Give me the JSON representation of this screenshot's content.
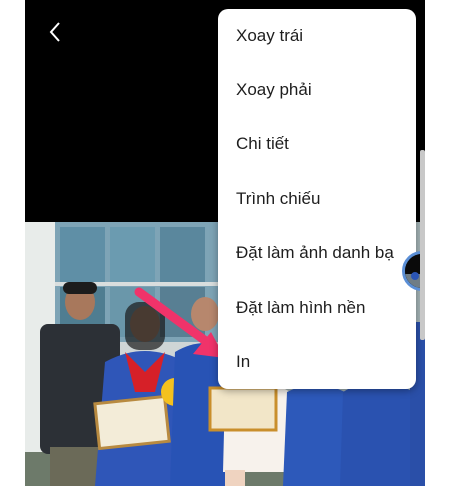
{
  "menu": {
    "items": [
      {
        "label": "Xoay trái"
      },
      {
        "label": "Xoay phải"
      },
      {
        "label": "Chi tiết"
      },
      {
        "label": "Trình chiếu"
      },
      {
        "label": "Đặt làm ảnh danh bạ"
      },
      {
        "label": "Đặt làm hình nền"
      },
      {
        "label": "In"
      }
    ]
  },
  "icons": {
    "back": "chevron-left-icon",
    "pointer": "arrow-icon"
  },
  "colors": {
    "background": "#000000",
    "menu_background": "#ffffff",
    "menu_text": "#1e1e1e",
    "arrow": "#f0336a",
    "thumb_ring": "#5b8fd6"
  }
}
